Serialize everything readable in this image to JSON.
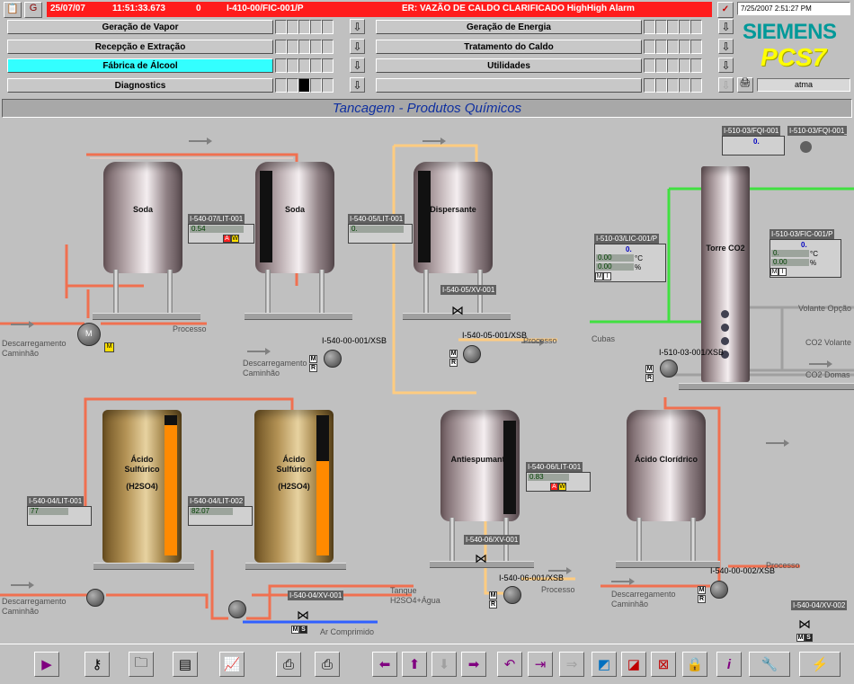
{
  "header": {
    "date": "25/07/07",
    "time": "11:51:33.673",
    "alarm_count": "0",
    "alarm_tag": "I-410-00/FIC-001/P",
    "alarm_text": "ER: VAZÃO DE CALDO CLARIFICADO HighHigh Alarm",
    "system_datetime": "7/25/2007 2:51:27 PM",
    "brand": "SIEMENS",
    "product": "PCS7",
    "user": "atma"
  },
  "nav": {
    "left": [
      {
        "label": "Geração de Vapor"
      },
      {
        "label": "Recepção e Extração"
      },
      {
        "label": "Fábrica de Álcool",
        "active": true
      },
      {
        "label": "Diagnostics"
      }
    ],
    "right": [
      {
        "label": "Geração de Energia"
      },
      {
        "label": "Tratamento do Caldo"
      },
      {
        "label": "Utilidades"
      },
      {
        "label": ""
      }
    ]
  },
  "screen_title": "Tancagem - Produtos Químicos",
  "tanks": {
    "soda1": "Soda",
    "soda2": "Soda",
    "dispersante": "Dispersante",
    "torre": "Torre CO2",
    "acido1_l1": "Ácido",
    "acido1_l2": "Sulfúrico",
    "acido1_l3": "(H2SO4)",
    "acido2_l1": "Ácido",
    "acido2_l2": "Sulfúrico",
    "acido2_l3": "(H2SO4)",
    "antiespumante": "Antiespumante",
    "cloridrico": "Ácido Clorídrico"
  },
  "tags": {
    "lit_soda": "I-540-07/LIT-001",
    "lit_soda_val": "0.54",
    "lit_disp": "I-540-05/LIT-001",
    "lit_disp_val": "0.",
    "xv_disp": "I-540-05/XV-001",
    "xsb_disp": "I-540-05-001/XSB",
    "xsb_soda": "I-540-00-001/XSB",
    "fqi_1": "I-510-03/FQI-001",
    "fqi_1_val": "0.",
    "fqi_rst": "I-510-03/FQI-001_RST",
    "lic_torre": "I-510-03/LIC-001/P",
    "lic_torre_val": "0.",
    "lic_torre_l2": "0.00",
    "lic_torre_l2_unit": "°C",
    "lic_torre_l3": "0.00",
    "lic_torre_l3_unit": "%",
    "fic_torre": "I-510-03/FIC-001/P",
    "fic_torre_val": "0.",
    "fic_torre_l2": "0.",
    "fic_torre_l2_unit": "°C",
    "fic_torre_l3": "0.00",
    "fic_torre_l3_unit": "%",
    "xsb_torre": "I-510-03-001/XSB",
    "lit_acido1": "I-540-04/LIT-001",
    "lit_acido1_val": "77",
    "lit_acido2": "I-540-04/LIT-002",
    "lit_acido2_val": "82.07",
    "lit_anti": "I-540-06/LIT-001",
    "lit_anti_val": "0.83",
    "xv_anti": "I-540-06/XV-001",
    "xsb_anti": "I-540-06-001/XSB",
    "xv_acido": "I-540-04/XV-001",
    "xsb_clor": "I-540-00-002/XSB",
    "xv_right": "I-540-04/XV-002"
  },
  "labels": {
    "descarregamento1": "Descarregamento",
    "caminhao1": "Caminhão",
    "processo1": "Processo",
    "descarregamento2": "Descarregamento",
    "caminhao2": "Caminhão",
    "processo2": "Processo",
    "cubas": "Cubas",
    "volante_opcao": "Volante Opção",
    "co2_volante": "CO2 Volante",
    "co2_domas": "CO2 Domas",
    "descarregamento3": "Descarregamento",
    "caminhao3": "Caminhão",
    "tanque_l1": "Tanque",
    "tanque_l2": "H2SO4+Água",
    "ar_comprimido": "Ar Comprimido",
    "processo3": "Processo",
    "descarregamento4": "Descarregamento",
    "caminhao4": "Caminhão",
    "processo4": "Processo",
    "m": "M",
    "r": "R",
    "s": "S",
    "i": "I",
    "a": "A",
    "w": "W"
  },
  "levels": {
    "acido1": 0.93,
    "acido2": 0.67,
    "soda2": 0.95,
    "dispersante": 0.95,
    "antiespumante": 0.95
  },
  "colors": {
    "alarm": "#ff1c1c",
    "active_nav": "#33ffff",
    "pipe_red": "#f07050",
    "pipe_orange": "#ffcc80",
    "pipe_green": "#40e040",
    "pipe_blue": "#3060ff",
    "siemens": "#009999",
    "pcs7": "#ffff00"
  }
}
